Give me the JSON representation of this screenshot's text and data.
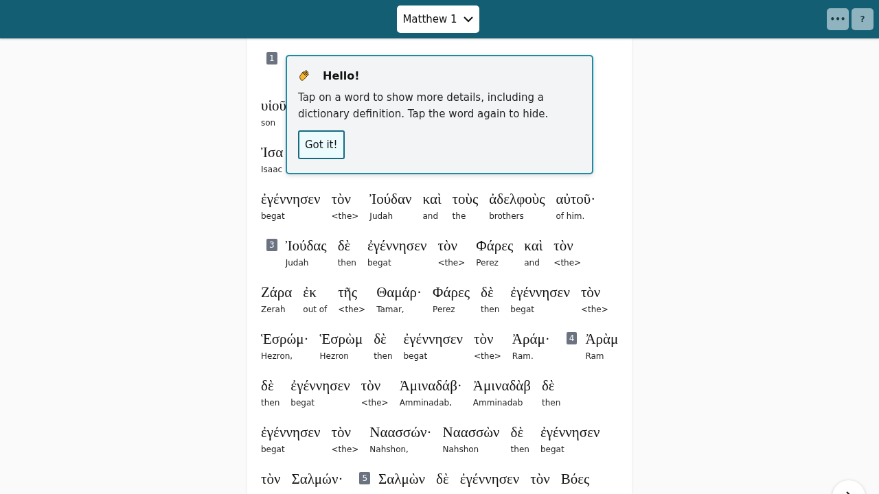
{
  "header": {
    "chapter": "Matthew 1",
    "buttons": [
      {
        "label": "•••"
      },
      {
        "label": "?"
      }
    ]
  },
  "lines": [
    [
      {
        "kind": "verse",
        "number": "1"
      }
    ],
    [
      {
        "kind": "word",
        "greek": "υἱοῦ",
        "gloss": "son"
      }
    ],
    [
      {
        "kind": "word",
        "greek": "Ἰσα",
        "gloss": "Isaac"
      }
    ],
    [
      {
        "kind": "word",
        "greek": "ἐγέννησεν",
        "gloss": "begat"
      },
      {
        "kind": "word",
        "greek": "τὸν",
        "gloss": "<the>"
      },
      {
        "kind": "word",
        "greek": "Ἰούδαν",
        "gloss": "Judah"
      },
      {
        "kind": "word",
        "greek": "καὶ",
        "gloss": "and"
      },
      {
        "kind": "word",
        "greek": "τοὺς",
        "gloss": "the"
      },
      {
        "kind": "word",
        "greek": "ἀδελφοὺς",
        "gloss": "brothers"
      },
      {
        "kind": "word",
        "greek": "αὐτοῦ·",
        "gloss": "of him."
      }
    ],
    [
      {
        "kind": "verse",
        "number": "3"
      },
      {
        "kind": "word",
        "greek": "Ἰούδας",
        "gloss": "Judah"
      },
      {
        "kind": "word",
        "greek": "δὲ",
        "gloss": "then"
      },
      {
        "kind": "word",
        "greek": "ἐγέννησεν",
        "gloss": "begat"
      },
      {
        "kind": "word",
        "greek": "τὸν",
        "gloss": "<the>"
      },
      {
        "kind": "word",
        "greek": "Φάρες",
        "gloss": "Perez"
      },
      {
        "kind": "word",
        "greek": "καὶ",
        "gloss": "and"
      },
      {
        "kind": "word",
        "greek": "τὸν",
        "gloss": "<the>"
      }
    ],
    [
      {
        "kind": "word",
        "greek": "Ζάρα",
        "gloss": "Zerah"
      },
      {
        "kind": "word",
        "greek": "ἐκ",
        "gloss": "out of"
      },
      {
        "kind": "word",
        "greek": "τῆς",
        "gloss": "<the>"
      },
      {
        "kind": "word",
        "greek": "Θαμάρ·",
        "gloss": "Tamar,"
      },
      {
        "kind": "word",
        "greek": "Φάρες",
        "gloss": "Perez"
      },
      {
        "kind": "word",
        "greek": "δὲ",
        "gloss": "then"
      },
      {
        "kind": "word",
        "greek": "ἐγέννησεν",
        "gloss": "begat"
      },
      {
        "kind": "word",
        "greek": "τὸν",
        "gloss": "<the>"
      }
    ],
    [
      {
        "kind": "word",
        "greek": "Ἑσρώμ·",
        "gloss": "Hezron,"
      },
      {
        "kind": "word",
        "greek": "Ἑσρὼμ",
        "gloss": "Hezron"
      },
      {
        "kind": "word",
        "greek": "δὲ",
        "gloss": "then"
      },
      {
        "kind": "word",
        "greek": "ἐγέννησεν",
        "gloss": "begat"
      },
      {
        "kind": "word",
        "greek": "τὸν",
        "gloss": "<the>"
      },
      {
        "kind": "word",
        "greek": "Ἀράμ·",
        "gloss": "Ram."
      },
      {
        "kind": "verse",
        "number": "4"
      },
      {
        "kind": "word",
        "greek": "Ἀρὰμ",
        "gloss": "Ram"
      }
    ],
    [
      {
        "kind": "word",
        "greek": "δὲ",
        "gloss": "then"
      },
      {
        "kind": "word",
        "greek": "ἐγέννησεν",
        "gloss": "begat"
      },
      {
        "kind": "word",
        "greek": "τὸν",
        "gloss": "<the>"
      },
      {
        "kind": "word",
        "greek": "Ἀμιναδάβ·",
        "gloss": "Amminadab,"
      },
      {
        "kind": "word",
        "greek": "Ἀμιναδὰβ",
        "gloss": "Amminadab"
      },
      {
        "kind": "word",
        "greek": "δὲ",
        "gloss": "then"
      }
    ],
    [
      {
        "kind": "word",
        "greek": "ἐγέννησεν",
        "gloss": "begat"
      },
      {
        "kind": "word",
        "greek": "τὸν",
        "gloss": "<the>"
      },
      {
        "kind": "word",
        "greek": "Ναασσών·",
        "gloss": "Nahshon,"
      },
      {
        "kind": "word",
        "greek": "Ναασσὼν",
        "gloss": "Nahshon"
      },
      {
        "kind": "word",
        "greek": "δὲ",
        "gloss": "then"
      },
      {
        "kind": "word",
        "greek": "ἐγέννησεν",
        "gloss": "begat"
      }
    ],
    [
      {
        "kind": "word",
        "greek": "τὸν"
      },
      {
        "kind": "word",
        "greek": "Σαλμών·"
      },
      {
        "kind": "verse",
        "number": "5"
      },
      {
        "kind": "word",
        "greek": "Σαλμὼν"
      },
      {
        "kind": "word",
        "greek": "δὲ"
      },
      {
        "kind": "word",
        "greek": "ἐγέννησεν"
      },
      {
        "kind": "word",
        "greek": "τὸν"
      },
      {
        "kind": "word",
        "greek": "Βόες"
      }
    ]
  ],
  "popover": {
    "title": "Hello!",
    "text": "Tap on a word to show more details, including a dictionary definition. Tap the word again to hide.",
    "button": "Got it!"
  }
}
